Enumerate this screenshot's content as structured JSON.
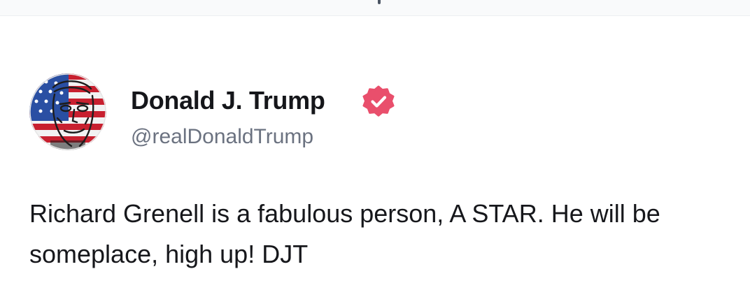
{
  "post": {
    "author": {
      "display_name": "Donald J. Trump",
      "handle": "@realDonaldTrump",
      "verified": true,
      "avatar_icon": "flag-portrait-avatar"
    },
    "body": "Richard Grenell is a fabulous person, A STAR. He will be someplace, high up! DJT"
  },
  "colors": {
    "verified_badge": "#e94f6c",
    "handle_text": "#6b7280",
    "body_text": "#16171b"
  }
}
